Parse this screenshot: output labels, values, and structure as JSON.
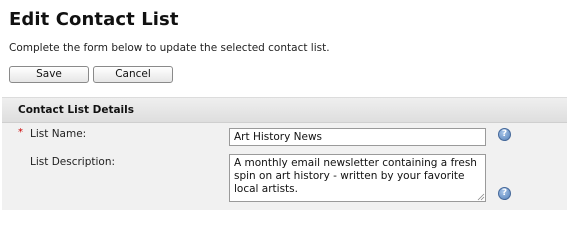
{
  "page": {
    "title": "Edit Contact List",
    "intro": "Complete the form below to update the selected contact list."
  },
  "toolbar": {
    "save_label": "Save",
    "cancel_label": "Cancel"
  },
  "section": {
    "title": "Contact List Details"
  },
  "form": {
    "required_marker": "*",
    "name": {
      "label": "List Name:",
      "value": "Art History News"
    },
    "description": {
      "label": "List Description:",
      "value": "A monthly email newsletter containing a fresh spin on art history - written by your favorite local artists."
    },
    "help_glyph": "?"
  },
  "icons": {
    "help": "help-icon",
    "resize": "resize-grip-icon"
  },
  "colors": {
    "required": "#cc0000",
    "help_icon": "#5480b8",
    "section_bg": "#f1f1f1"
  }
}
